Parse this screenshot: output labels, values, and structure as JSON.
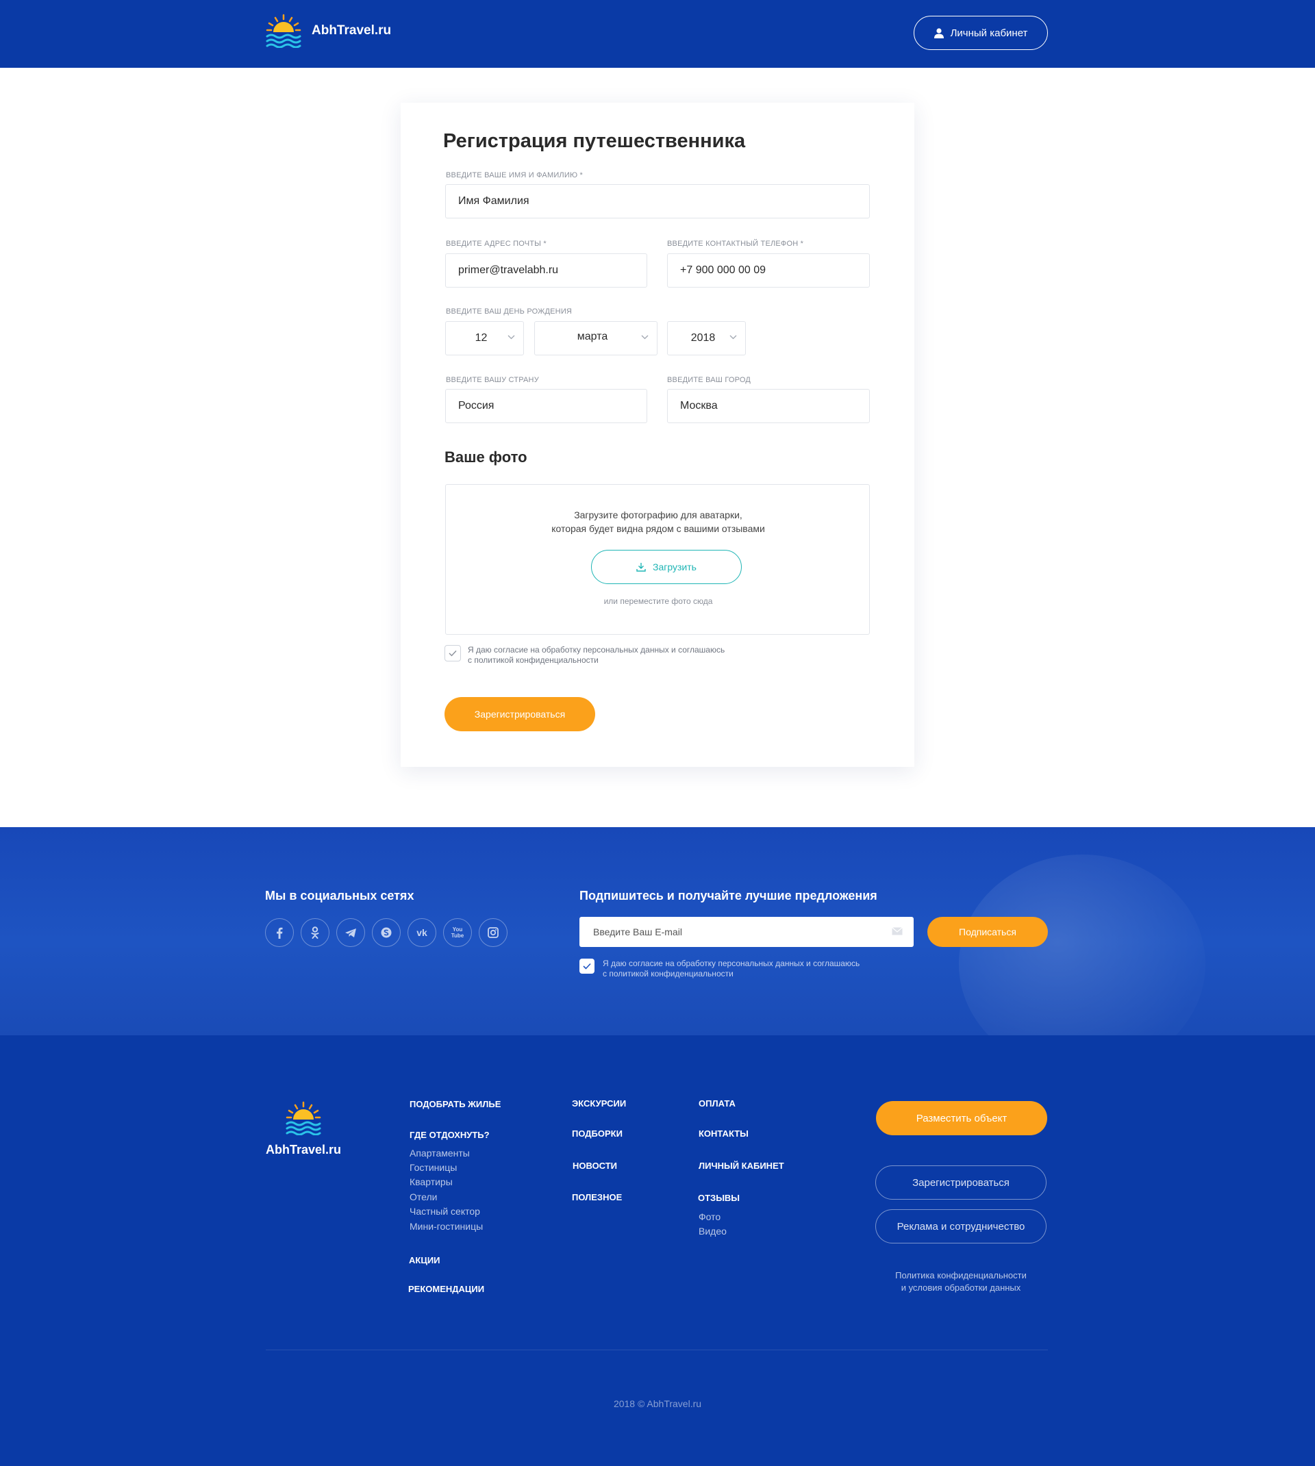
{
  "header": {
    "logo_text": "AbhTravel.ru",
    "cabinet_label": "Личный кабинет"
  },
  "form": {
    "title": "Регистрация путешественника",
    "name_label": "ВВЕДИТЕ ВАШЕ ИМЯ И ФАМИЛИЮ *",
    "name_value": "Имя Фамилия",
    "email_label": "ВВЕДИТЕ АДРЕС ПОЧТЫ *",
    "email_value": "primer@travelabh.ru",
    "phone_label": "ВВЕДИТЕ КОНТАКТНЫЙ ТЕЛЕФОН *",
    "phone_value": "+7 900 000 00 09",
    "birthday_label": "ВВЕДИТЕ ВАШ ДЕНЬ РОЖДЕНИЯ",
    "day": "12",
    "month": "марта",
    "year": "2018",
    "country_label": "ВВЕДИТЕ ВАШУ СТРАНУ",
    "country_value": "Россия",
    "city_label": "ВВЕДИТЕ ВАШ ГОРОД",
    "city_value": "Москва",
    "photo_title": "Ваше фото",
    "upload_text_1": "Загрузите фотографию для аватарки,",
    "upload_text_2": "которая будет видна рядом с вашими отзывами",
    "upload_button": "Загрузить",
    "upload_hint": "или переместите фото сюда",
    "consent_1": "Я даю согласие на обработку персональных данных и соглашаюсь",
    "consent_2": "с политикой конфиденциальности",
    "submit": "Зарегистрироваться"
  },
  "social": {
    "title": "Мы в социальных сетях",
    "icons": [
      "facebook-icon",
      "odnoklassniki-icon",
      "telegram-icon",
      "skype-icon",
      "vk-icon",
      "youtube-icon",
      "instagram-icon"
    ],
    "vk_glyph": "vk",
    "youtube_glyph": "You Tube",
    "subscribe_title": "Подпишитесь и получайте лучшие предложения",
    "email_placeholder": "Введите Ваш E-mail",
    "subscribe_button": "Подписаться",
    "consent_1": "Я даю согласие на обработку персональных данных и соглашаюсь",
    "consent_2": "с политикой конфиденциальности"
  },
  "footer": {
    "logo_text": "AbhTravel.ru",
    "col1": {
      "pick": "ПОДОБРАТЬ ЖИЛЬЕ",
      "where": "ГДЕ ОТДОХНУТЬ?",
      "links": [
        "Апартаменты",
        "Гостиницы",
        "Квартиры",
        "Отели",
        "Частный сектор",
        "Мини-гостиницы"
      ],
      "promos": "АКЦИИ",
      "recs": "РЕКОМЕНДАЦИИ"
    },
    "col2": [
      "ЭКСКУРСИИ",
      "ПОДБОРКИ",
      "НОВОСТИ",
      "ПОЛЕЗНОЕ"
    ],
    "col3": {
      "payment": "ОПЛАТА",
      "contacts": "КОНТАКТЫ",
      "cabinet": "ЛИЧНЫЙ КАБИНЕТ",
      "reviews": "ОТЗЫВЫ",
      "links": [
        "Фото",
        "Видео"
      ]
    },
    "place_button": "Разместить объект",
    "register_button": "Зарегистрироваться",
    "ads_button": "Реклама и сотрудничество",
    "policy_1": "Политика конфиденциальности",
    "policy_2": "и условия обработки данных",
    "copyright": "2018 © AbhTravel.ru"
  },
  "colors": {
    "header_blue": "#0a3aa6",
    "accent_orange": "#fba11b",
    "accent_teal": "#1fb5b5"
  }
}
